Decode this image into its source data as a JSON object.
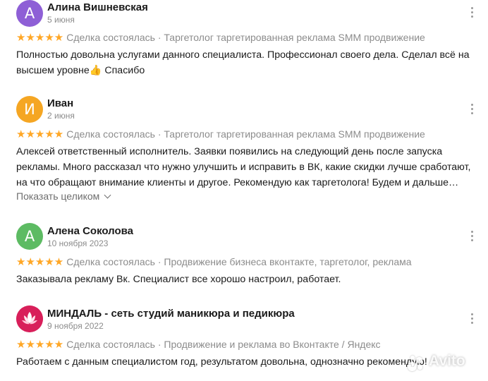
{
  "reviews": [
    {
      "avatar_letter": "А",
      "avatar_color": "#8e5fd6",
      "name": "Алина Вишневская",
      "date": "5 июня",
      "stars": "★★★★★",
      "deal": "Сделка состоялась · Таргетолог таргетированная реклама SMM продвижение",
      "text": "Полностью довольна услугами данного специалиста. Профессионал своего дела. Сделал всё на высшем уровне👍 Спасибо"
    },
    {
      "avatar_letter": "И",
      "avatar_color": "#f5a623",
      "name": "Иван",
      "date": "2 июня",
      "stars": "★★★★★",
      "deal": "Сделка состоялась · Таргетолог таргетированная реклама SMM продвижение",
      "text": "Алексей ответственный исполнитель. Заявки появились на следующий день после запуска рекламы. Много рассказал что нужно улучшить и исправить в ВК, какие скидки лучше сработают, на что обращают внимание клиенты и другое. Рекомендую как таргетолога! Будем и дальше…",
      "show_more": "Показать целиком"
    },
    {
      "avatar_letter": "А",
      "avatar_color": "#5dbb63",
      "name": "Алена Соколова",
      "date": "10 ноября 2023",
      "stars": "★★★★★",
      "deal": "Сделка состоялась · Продвижение бизнеса вконтакте, таргетолог, реклама",
      "text": "Заказывала рекламу Вк. Специалист все хорошо настроил, работает."
    },
    {
      "avatar_logo": "lotus-logo",
      "avatar_color": "#d81f5a",
      "name": "МИНДАЛЬ - сеть студий маникюра и педикюра",
      "date": "9 ноября 2022",
      "stars": "★★★★★",
      "deal": "Сделка состоялась · Продвижение и реклама во Вконтакте / Яндекс",
      "text": "Работаем с данным специалистом год, результатом довольна, однозначно рекомендую!"
    }
  ],
  "watermark": "Avito"
}
